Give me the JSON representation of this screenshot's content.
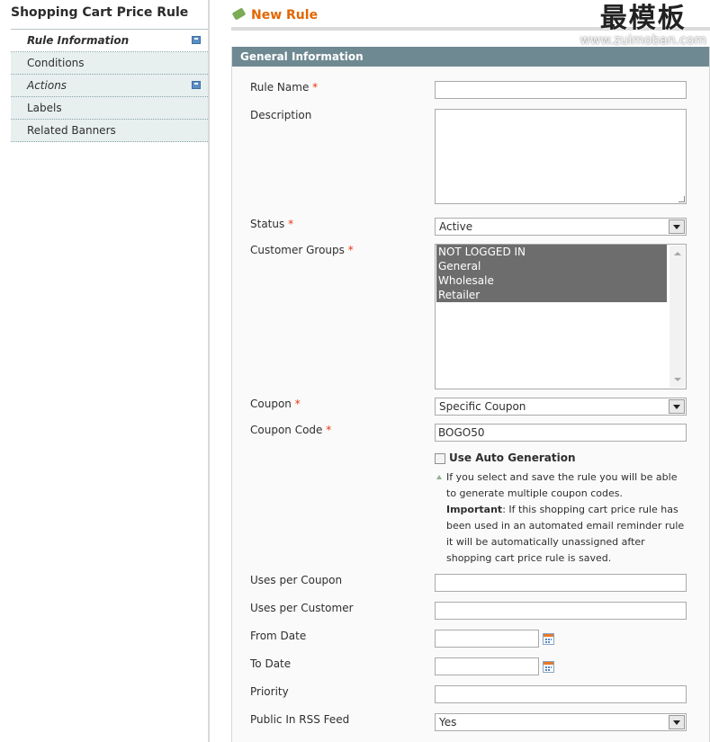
{
  "sidebar": {
    "title": "Shopping Cart Price Rule",
    "tabs": [
      {
        "label": "Rule Information"
      },
      {
        "label": "Conditions"
      },
      {
        "label": "Actions"
      },
      {
        "label": "Labels"
      },
      {
        "label": "Related Banners"
      }
    ]
  },
  "header": {
    "title": "New Rule",
    "watermark_cn": "最模板",
    "watermark_url": "www.zuimoban.com"
  },
  "form": {
    "legend": "General Information",
    "required_mark": "*",
    "rule_name": {
      "label": "Rule Name",
      "value": ""
    },
    "description": {
      "label": "Description",
      "value": ""
    },
    "status": {
      "label": "Status",
      "value": "Active"
    },
    "customer_groups": {
      "label": "Customer Groups",
      "options": [
        "NOT LOGGED IN",
        "General",
        "Wholesale",
        "Retailer"
      ]
    },
    "coupon": {
      "label": "Coupon",
      "value": "Specific Coupon"
    },
    "coupon_code": {
      "label": "Coupon Code",
      "value": "BOGO50"
    },
    "auto_generation": {
      "label": "Use Auto Generation",
      "note_1": "If you select and save the rule you will be able to generate multiple coupon codes.",
      "note_important": "Important",
      "note_2": ": If this shopping cart price rule has been used in an automated email reminder rule it will be automatically unassigned after shopping cart price rule is saved."
    },
    "uses_per_coupon": {
      "label": "Uses per Coupon",
      "value": ""
    },
    "uses_per_customer": {
      "label": "Uses per Customer",
      "value": ""
    },
    "from_date": {
      "label": "From Date",
      "value": ""
    },
    "to_date": {
      "label": "To Date",
      "value": ""
    },
    "priority": {
      "label": "Priority",
      "value": ""
    },
    "rss_feed": {
      "label": "Public In RSS Feed",
      "value": "Yes"
    }
  }
}
